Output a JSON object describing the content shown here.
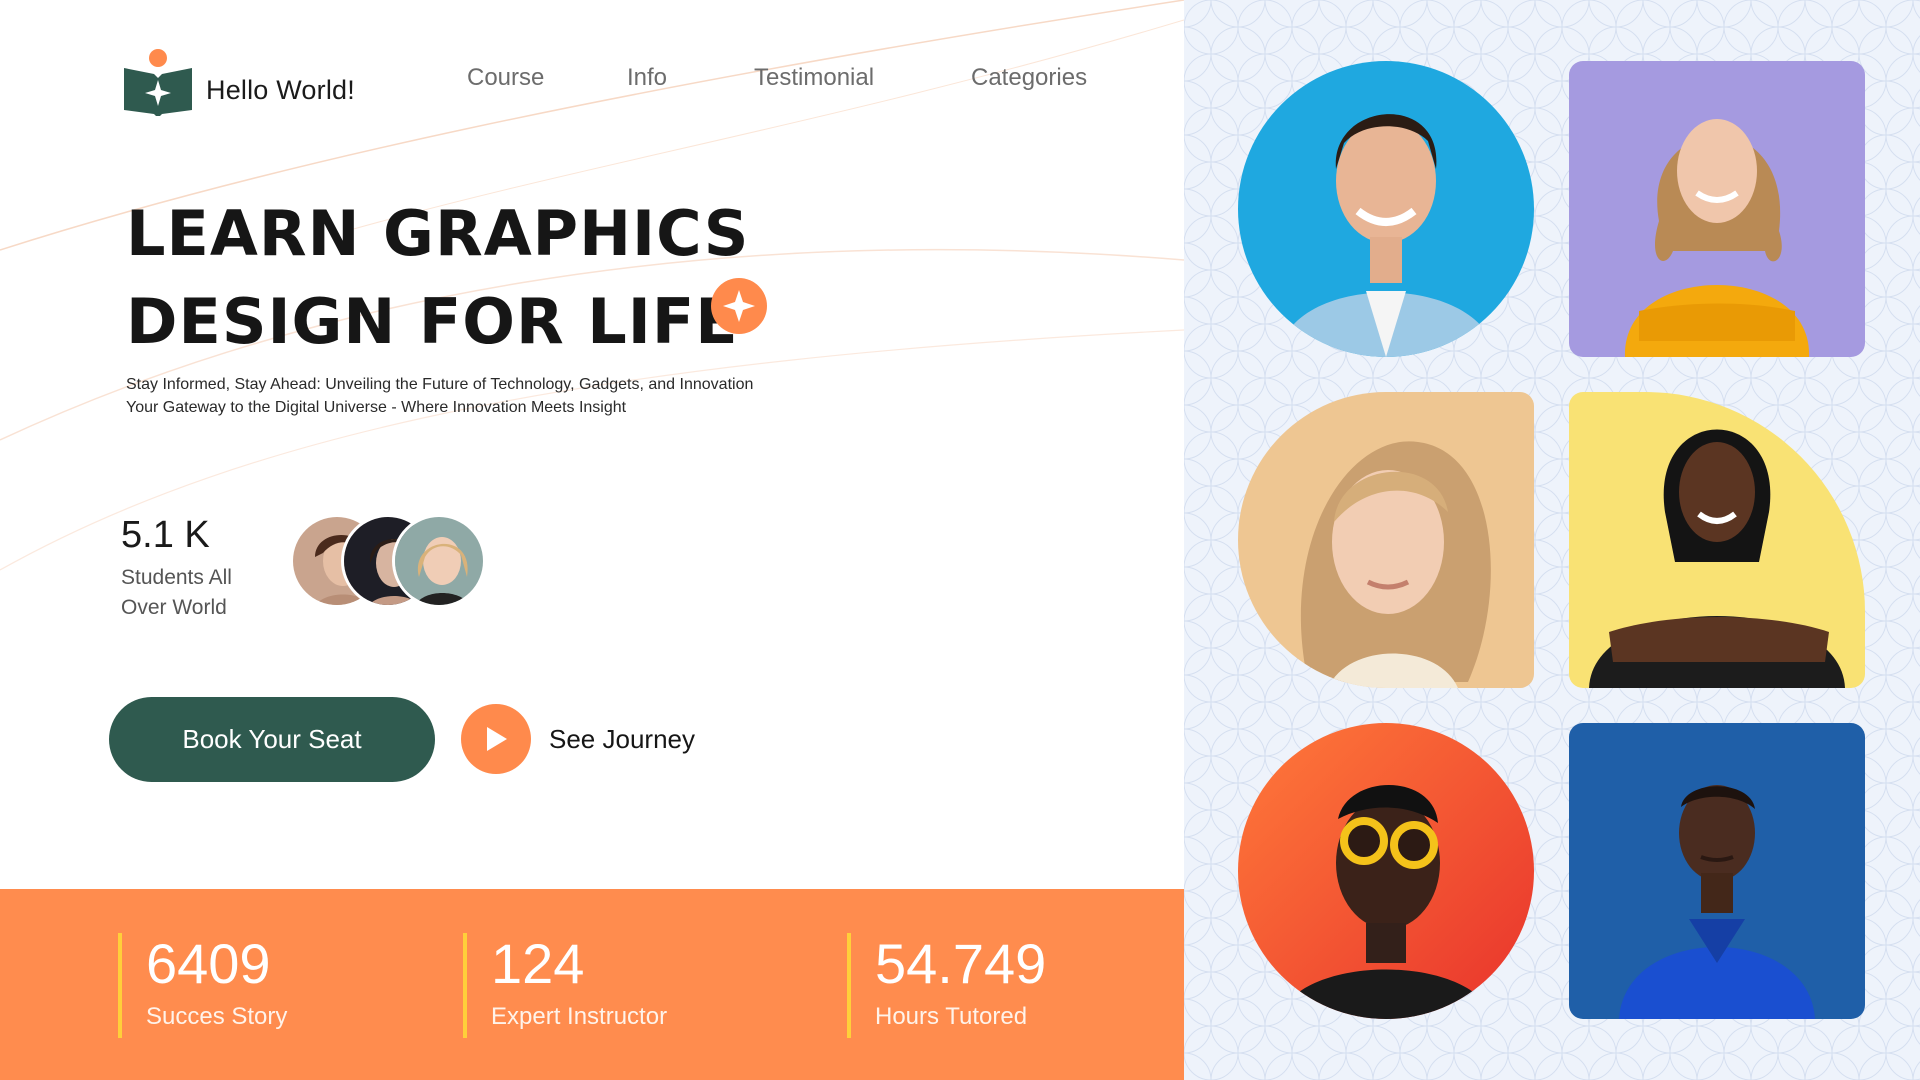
{
  "brand": {
    "name": "Hello World!"
  },
  "nav": {
    "items": [
      "Course",
      "Info",
      "Testimonial",
      "Categories"
    ]
  },
  "hero": {
    "title_line1": "LEARN GRAPHICS",
    "title_line2": "DESIGN FOR LIFE",
    "subtitle_line1": "Stay Informed, Stay Ahead: Unveiling the Future of Technology, Gadgets, and Innovation",
    "subtitle_line2": "Your Gateway to the Digital Universe - Where Innovation Meets Insight"
  },
  "students": {
    "count": "5.1 K",
    "label": "Students All Over World"
  },
  "actions": {
    "book_label": "Book Your Seat",
    "journey_label": "See Journey"
  },
  "stats": [
    {
      "value": "6409",
      "label": "Succes Story"
    },
    {
      "value": "124",
      "label": "Expert Instructor"
    },
    {
      "value": "54.749",
      "label": "Hours Tutored"
    }
  ],
  "colors": {
    "brand_green": "#2f5a4f",
    "accent_orange": "#ff8a4c",
    "stats_bar": "#ff8c4e",
    "stat_divider": "#ffcf3a",
    "right_panel_bg": "#eef3fb"
  },
  "icons": {
    "logo": "open-book-sparkle-icon",
    "title_badge": "sparkle-icon",
    "play": "play-icon"
  }
}
